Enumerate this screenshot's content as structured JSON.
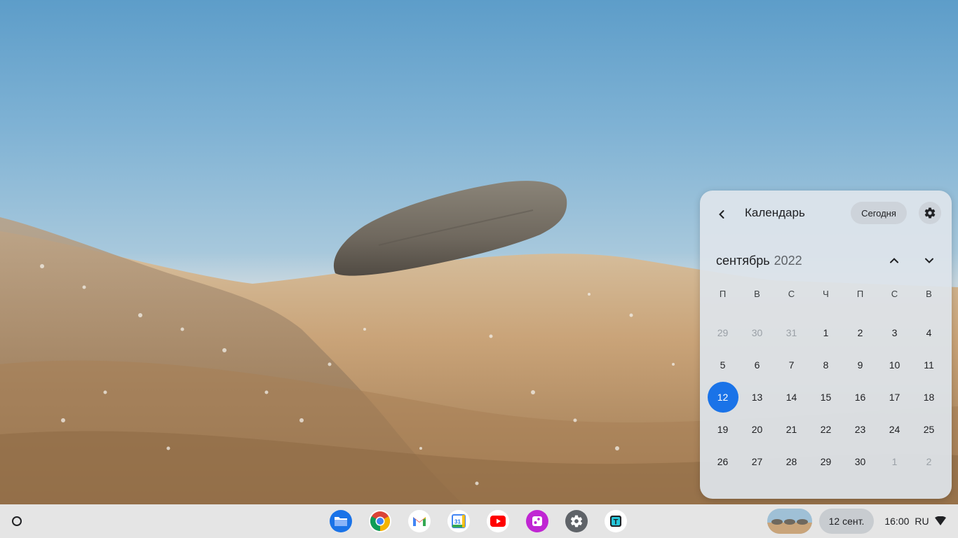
{
  "calendar": {
    "title": "Календарь",
    "today_label": "Сегодня",
    "month": "сентябрь",
    "year": "2022",
    "weekdays": [
      "П",
      "В",
      "С",
      "Ч",
      "П",
      "С",
      "В"
    ],
    "weeks": [
      [
        {
          "d": "29",
          "muted": true
        },
        {
          "d": "30",
          "muted": true
        },
        {
          "d": "31",
          "muted": true
        },
        {
          "d": "1"
        },
        {
          "d": "2"
        },
        {
          "d": "3"
        },
        {
          "d": "4"
        }
      ],
      [
        {
          "d": "5"
        },
        {
          "d": "6"
        },
        {
          "d": "7"
        },
        {
          "d": "8"
        },
        {
          "d": "9"
        },
        {
          "d": "10"
        },
        {
          "d": "11"
        }
      ],
      [
        {
          "d": "12",
          "today": true
        },
        {
          "d": "13"
        },
        {
          "d": "14"
        },
        {
          "d": "15"
        },
        {
          "d": "16"
        },
        {
          "d": "17"
        },
        {
          "d": "18"
        }
      ],
      [
        {
          "d": "19"
        },
        {
          "d": "20"
        },
        {
          "d": "21"
        },
        {
          "d": "22"
        },
        {
          "d": "23"
        },
        {
          "d": "24"
        },
        {
          "d": "25"
        }
      ],
      [
        {
          "d": "26"
        },
        {
          "d": "27"
        },
        {
          "d": "28"
        },
        {
          "d": "29"
        },
        {
          "d": "30"
        },
        {
          "d": "1",
          "muted": true
        },
        {
          "d": "2",
          "muted": true
        }
      ]
    ],
    "accent_color": "#1a73e8"
  },
  "shelf": {
    "apps": [
      {
        "name": "files-app-icon",
        "icon": "files-icon"
      },
      {
        "name": "chrome-app-icon",
        "icon": "chrome-icon"
      },
      {
        "name": "gmail-app-icon",
        "icon": "gmail-icon"
      },
      {
        "name": "calendar-app-icon",
        "icon": "calendar-icon",
        "label": "31"
      },
      {
        "name": "youtube-app-icon",
        "icon": "youtube-icon"
      },
      {
        "name": "gallery-app-icon",
        "icon": "gallery-icon"
      },
      {
        "name": "settings-app-icon",
        "icon": "settings-icon"
      },
      {
        "name": "text-app-icon",
        "icon": "text-icon",
        "label": "T"
      }
    ],
    "date": "12 сент.",
    "time": "16:00",
    "input_method": "RU"
  }
}
